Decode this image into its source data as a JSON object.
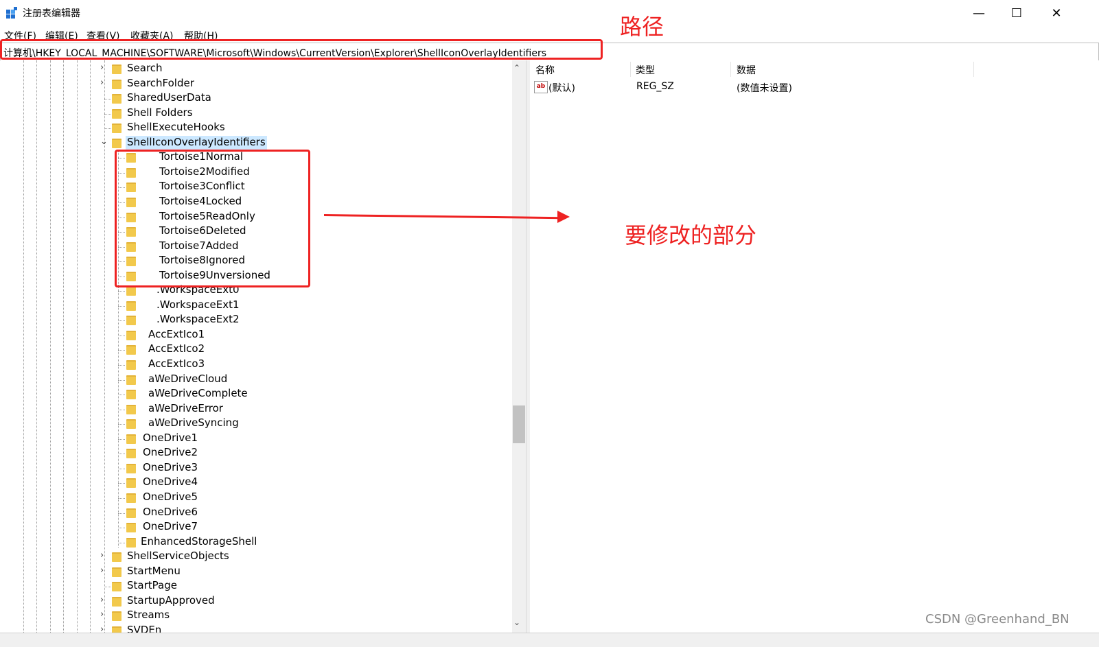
{
  "window": {
    "title": "注册表编辑器",
    "minimize": "—",
    "maximize": "☐",
    "close": "✕"
  },
  "menu": [
    "文件(F)",
    "编辑(E)",
    "查看(V)",
    "收藏夹(A)",
    "帮助(H)"
  ],
  "address": "计算机\\HKEY_LOCAL_MACHINE\\SOFTWARE\\Microsoft\\Windows\\CurrentVersion\\Explorer\\ShellIconOverlayIdentifiers",
  "tree": [
    {
      "label": "Search",
      "expander": "›"
    },
    {
      "label": "SearchFolder",
      "expander": "›"
    },
    {
      "label": "SharedUserData",
      "expander": ""
    },
    {
      "label": "Shell Folders",
      "expander": ""
    },
    {
      "label": "ShellExecuteHooks",
      "expander": ""
    },
    {
      "label": "ShellIconOverlayIdentifiers",
      "expander": "⌄",
      "selected": true
    },
    {
      "label": "Tortoise1Normal"
    },
    {
      "label": "Tortoise2Modified"
    },
    {
      "label": "Tortoise3Conflict"
    },
    {
      "label": "Tortoise4Locked"
    },
    {
      "label": "Tortoise5ReadOnly"
    },
    {
      "label": "Tortoise6Deleted"
    },
    {
      "label": "Tortoise7Added"
    },
    {
      "label": "Tortoise8Ignored"
    },
    {
      "label": "Tortoise9Unversioned"
    },
    {
      "label": ".WorkspaceExt0"
    },
    {
      "label": ".WorkspaceExt1"
    },
    {
      "label": ".WorkspaceExt2"
    },
    {
      "label": "AccExtIco1"
    },
    {
      "label": "AccExtIco2"
    },
    {
      "label": "AccExtIco3"
    },
    {
      "label": "aWeDriveCloud"
    },
    {
      "label": "aWeDriveComplete"
    },
    {
      "label": "aWeDriveError"
    },
    {
      "label": "aWeDriveSyncing"
    },
    {
      "label": "OneDrive1"
    },
    {
      "label": "OneDrive2"
    },
    {
      "label": "OneDrive3"
    },
    {
      "label": "OneDrive4"
    },
    {
      "label": "OneDrive5"
    },
    {
      "label": "OneDrive6"
    },
    {
      "label": "OneDrive7"
    },
    {
      "label": "EnhancedStorageShell"
    },
    {
      "label": "ShellServiceObjects",
      "expander": "›"
    },
    {
      "label": "StartMenu",
      "expander": "›"
    },
    {
      "label": "StartPage",
      "expander": ""
    },
    {
      "label": "StartupApproved",
      "expander": "›"
    },
    {
      "label": "Streams",
      "expander": "›"
    },
    {
      "label": "SVDEn",
      "expander": "›"
    }
  ],
  "list": {
    "columns": [
      "名称",
      "类型",
      "数据"
    ],
    "rows": [
      {
        "name": "(默认)",
        "type": "REG_SZ",
        "data": "(数值未设置)"
      }
    ]
  },
  "annotations": {
    "path": "路径",
    "modify": "要修改的部分"
  },
  "watermark": "CSDN @Greenhand_BN",
  "colors": {
    "annotation": "#ee2222",
    "selection": "#cce8ff",
    "folder": "#f2c94c"
  }
}
